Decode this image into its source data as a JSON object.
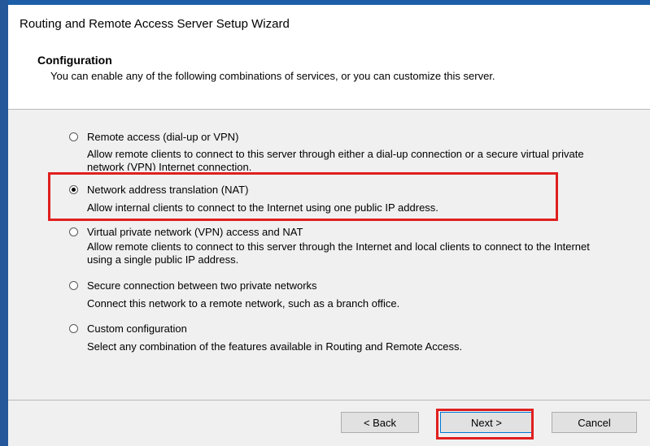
{
  "window": {
    "title": "Routing and Remote Access Server Setup Wizard"
  },
  "header": {
    "title": "Configuration",
    "description": "You can enable any of the following combinations of services, or you can customize this server."
  },
  "options": [
    {
      "label": "Remote access (dial-up or VPN)",
      "description": "Allow remote clients to connect to this server through either a dial-up connection or a secure virtual private network (VPN) Internet connection.",
      "selected": false
    },
    {
      "label": "Network address translation (NAT)",
      "description": "Allow internal clients to connect to the Internet using one public IP address.",
      "selected": true
    },
    {
      "label": "Virtual private network (VPN) access and NAT",
      "description": "Allow remote clients to connect to this server through the Internet and local clients to connect to the Internet using a single public IP address.",
      "selected": false
    },
    {
      "label": "Secure connection between two private networks",
      "description": "Connect this network to a remote network, such as a branch office.",
      "selected": false
    },
    {
      "label": "Custom configuration",
      "description": "Select any combination of the features available in Routing and Remote Access.",
      "selected": false
    }
  ],
  "buttons": {
    "back": "< Back",
    "next": "Next >",
    "cancel": "Cancel"
  },
  "colors": {
    "highlight": "#e01f1f",
    "frame": "#1c5fa8"
  }
}
